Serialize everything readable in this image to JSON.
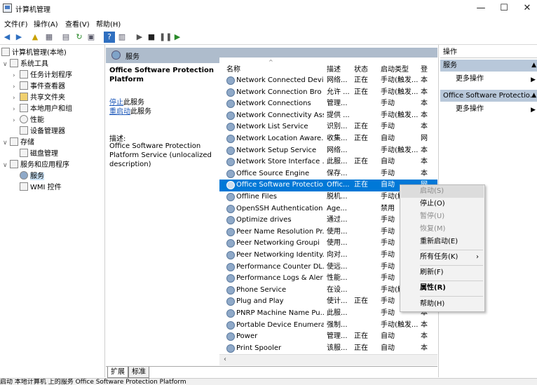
{
  "window": {
    "title": "计算机管理",
    "minimize_glyph": "—",
    "maximize_glyph": "☐",
    "close_glyph": "✕"
  },
  "menu": [
    "文件(F)",
    "操作(A)",
    "查看(V)",
    "帮助(H)"
  ],
  "tree": {
    "root": "计算机管理(本地)",
    "system_tools": "系统工具",
    "task_scheduler": "任务计划程序",
    "event_viewer": "事件查看器",
    "shared_folders": "共享文件夹",
    "local_users": "本地用户和组",
    "performance": "性能",
    "device_manager": "设备管理器",
    "storage": "存储",
    "disk_management": "磁盘管理",
    "services_apps": "服务和应用程序",
    "services": "服务",
    "wmi": "WMI 控件"
  },
  "panel_header": "服务",
  "detail": {
    "name": "Office Software Protection Platform",
    "stop_prefix": "停止",
    "stop_suffix": "此服务",
    "restart_prefix": "重启动",
    "restart_suffix": "此服务",
    "desc_label": "描述:",
    "desc_text": "Office Software Protection Platform Service (unlocalized description)"
  },
  "columns": {
    "name": "名称",
    "desc": "描述",
    "status": "状态",
    "startup": "启动类型",
    "logon": "登"
  },
  "services": [
    {
      "name": "Network Connected Devi...",
      "desc": "网络...",
      "status": "正在",
      "startup": "手动(触发...",
      "logon": "本"
    },
    {
      "name": "Network Connection Bro",
      "desc": "允许 ...",
      "status": "正在",
      "startup": "手动(触发...",
      "logon": "本"
    },
    {
      "name": "Network Connections",
      "desc": "管理...",
      "status": "",
      "startup": "手动",
      "logon": "本"
    },
    {
      "name": "Network Connectivity Ass...",
      "desc": "提供 ...",
      "status": "",
      "startup": "手动(触发...",
      "logon": "本"
    },
    {
      "name": "Network List Service",
      "desc": "识别...",
      "status": "正在",
      "startup": "手动",
      "logon": "本"
    },
    {
      "name": "Network Location Aware...",
      "desc": "收集...",
      "status": "正在",
      "startup": "自动",
      "logon": "网"
    },
    {
      "name": "Network Setup Service",
      "desc": "网络...",
      "status": "",
      "startup": "手动(触发...",
      "logon": "本"
    },
    {
      "name": "Network Store Interface ...",
      "desc": "此服...",
      "status": "正在",
      "startup": "自动",
      "logon": "本"
    },
    {
      "name": "Office  Source Engine",
      "desc": "保存...",
      "status": "",
      "startup": "手动",
      "logon": "本"
    },
    {
      "name": "Office Software Protectio...",
      "desc": "Offic...",
      "status": "正在",
      "startup": "自动",
      "logon": "网",
      "selected": true
    },
    {
      "name": "Offline Files",
      "desc": "脱机...",
      "status": "",
      "startup": "手动(触发...",
      "logon": "本"
    },
    {
      "name": "OpenSSH Authentication ...",
      "desc": "Age...",
      "status": "",
      "startup": "禁用",
      "logon": "本"
    },
    {
      "name": "Optimize drives",
      "desc": "通过...",
      "status": "",
      "startup": "手动",
      "logon": "本"
    },
    {
      "name": "Peer Name Resolution Pr...",
      "desc": "使用...",
      "status": "",
      "startup": "手动",
      "logon": "本"
    },
    {
      "name": "Peer Networking Groupi",
      "desc": "使用...",
      "status": "",
      "startup": "手动",
      "logon": "本"
    },
    {
      "name": "Peer Networking Identity...",
      "desc": "向对...",
      "status": "",
      "startup": "手动",
      "logon": "本"
    },
    {
      "name": "Performance Counter DL...",
      "desc": "使远...",
      "status": "",
      "startup": "手动",
      "logon": "本"
    },
    {
      "name": "Performance Logs & Aler",
      "desc": "性能...",
      "status": "",
      "startup": "手动",
      "logon": "本"
    },
    {
      "name": "Phone Service",
      "desc": "在设...",
      "status": "",
      "startup": "手动(触发...",
      "logon": "本"
    },
    {
      "name": "Plug and Play",
      "desc": "使计...",
      "status": "正在",
      "startup": "手动",
      "logon": "本"
    },
    {
      "name": "PNRP Machine Name Pu...",
      "desc": "此服...",
      "status": "",
      "startup": "手动",
      "logon": "本"
    },
    {
      "name": "Portable Device Enumera...",
      "desc": "强制...",
      "status": "",
      "startup": "手动(触发...",
      "logon": "本"
    },
    {
      "name": "Power",
      "desc": "管理...",
      "status": "正在",
      "startup": "自动",
      "logon": "本"
    },
    {
      "name": "Print Spooler",
      "desc": "该服...",
      "status": "正在",
      "startup": "自动",
      "logon": "本"
    }
  ],
  "tabs": [
    "扩展",
    "标准"
  ],
  "actions": {
    "header": "操作",
    "section1": "服务",
    "more1": "更多操作",
    "section2": "Office Software Protectio...",
    "more2": "更多操作"
  },
  "context_menu": [
    "启动(S)",
    "停止(O)",
    "暂停(U)",
    "恢复(M)",
    "重新启动(E)",
    "所有任务(K)",
    "刷新(F)",
    "属性(R)",
    "帮助(H)"
  ],
  "status_bar": "启动 本地计算机 上的服务 Office Software Protection Platform"
}
